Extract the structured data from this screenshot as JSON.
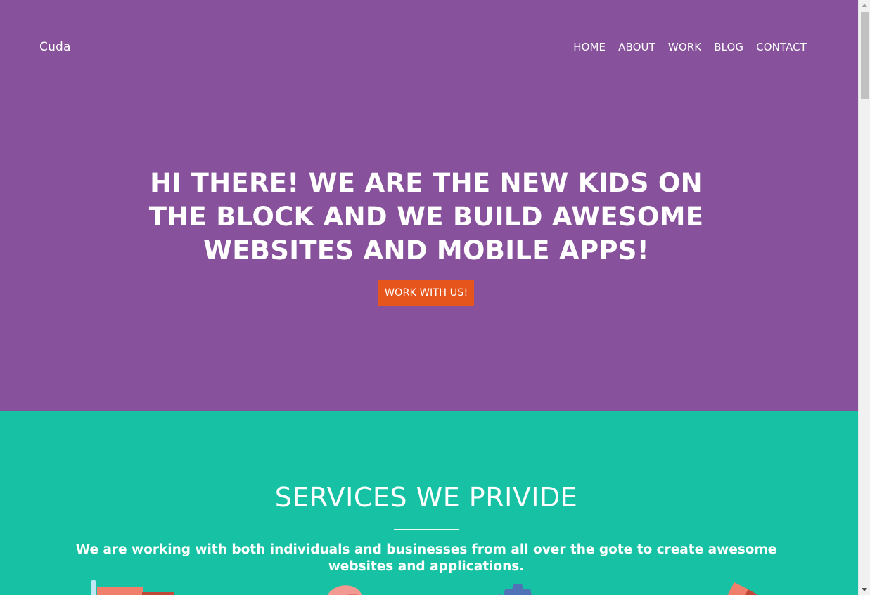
{
  "brand": {
    "name": "Cuda"
  },
  "nav": {
    "items": [
      {
        "label": "HOME"
      },
      {
        "label": "ABOUT"
      },
      {
        "label": "WORK"
      },
      {
        "label": "BLOG"
      },
      {
        "label": "CONTACT"
      }
    ]
  },
  "hero": {
    "heading": "HI THERE! WE ARE THE NEW KIDS ON THE BLOCK AND WE BUILD AWESOME WEBSITES AND MOBILE APPS!",
    "cta_label": "WORK WITH US!"
  },
  "services": {
    "title": "SERVICES WE PRIVIDE",
    "description": "We are working with both individuals and businesses from all over the gote to create awesome websites and applications.",
    "icons": [
      "cup-icon",
      "brush-icon",
      "gear-icon",
      "pencil-icon"
    ]
  },
  "colors": {
    "hero_bg": "#87529b",
    "services_bg": "#17c2a4",
    "cta_bg": "#e5551c"
  }
}
